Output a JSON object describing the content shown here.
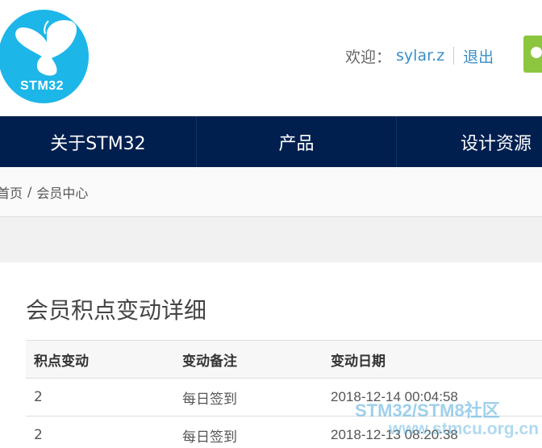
{
  "header": {
    "logo_text": "STM32",
    "welcome_label": "欢迎：",
    "username": "sylar.z",
    "logout_label": "退出"
  },
  "nav": {
    "items": [
      {
        "label": "关于STM32"
      },
      {
        "label": "产品"
      },
      {
        "label": "设计资源"
      }
    ]
  },
  "breadcrumb": {
    "home": "首页",
    "separator": "/",
    "current": "会员中心"
  },
  "main": {
    "title": "会员积点变动详细",
    "table": {
      "headers": [
        "积点变动",
        "变动备注",
        "变动日期"
      ],
      "rows": [
        [
          "2",
          "每日签到",
          "2018-12-14 00:04:58"
        ],
        [
          "2",
          "每日签到",
          "2018-12-13 08:20:38"
        ]
      ]
    }
  },
  "watermark": {
    "line1": "STM32/STM8社区",
    "line2": "www.stmcu.org.cn"
  },
  "colors": {
    "nav_bg": "#001f4f",
    "logo_bg": "#1db6e8",
    "link": "#3a8ec7",
    "accent_green": "#8cc63f"
  }
}
